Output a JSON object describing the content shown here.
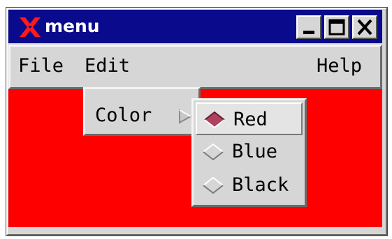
{
  "window": {
    "title": "menu",
    "app_icon": "x-logo-icon",
    "controls": [
      "minimize-icon",
      "maximize-icon",
      "close-icon"
    ]
  },
  "menubar": {
    "file_label": "File",
    "edit_label": "Edit",
    "help_label": "Help"
  },
  "edit_menu": {
    "items": [
      {
        "label": "Color",
        "icon": "cascade-arrow-icon"
      }
    ]
  },
  "color_submenu": {
    "items": [
      {
        "label": "Red",
        "selected": true
      },
      {
        "label": "Blue",
        "selected": false
      },
      {
        "label": "Black",
        "selected": false
      }
    ]
  },
  "colors": {
    "titlebar": "#0a0a8c",
    "content_background": "#ff0000",
    "radio_selected": "#b04060",
    "chrome": "#d6d6d6"
  }
}
